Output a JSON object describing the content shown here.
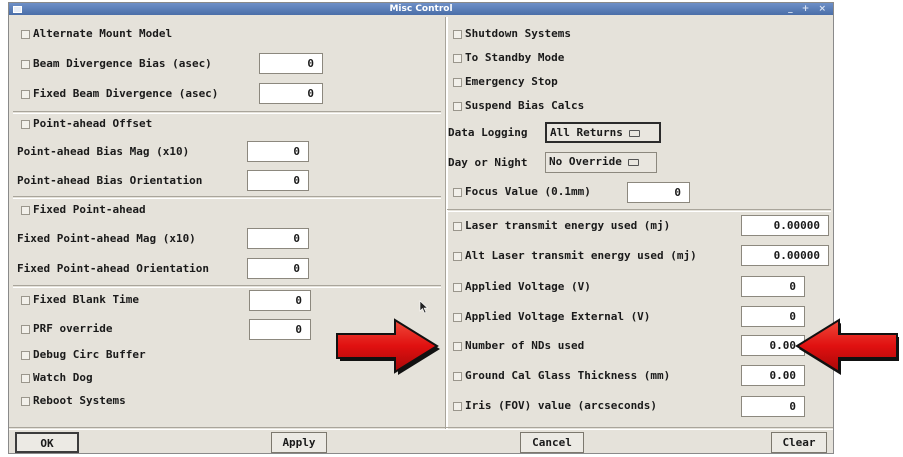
{
  "window": {
    "title": "Misc Control"
  },
  "left": {
    "alternate_mount_model": "Alternate Mount Model",
    "beam_divergence_bias": {
      "label": "Beam Divergence Bias   (asec)",
      "value": "0"
    },
    "fixed_beam_divergence": {
      "label": "Fixed Beam Divergence (asec)",
      "value": "0"
    },
    "point_ahead_offset": "Point-ahead Offset",
    "point_ahead_bias_mag": {
      "label": "Point-ahead Bias Mag (x10)",
      "value": "0"
    },
    "point_ahead_bias_orientation": {
      "label": "Point-ahead Bias Orientation",
      "value": "0"
    },
    "fixed_point_ahead": "Fixed Point-ahead",
    "fixed_point_ahead_mag": {
      "label": "Fixed Point-ahead Mag (x10)",
      "value": "0"
    },
    "fixed_point_ahead_orientation": {
      "label": "Fixed Point-ahead Orientation",
      "value": "0"
    },
    "fixed_blank_time": {
      "label": "Fixed Blank Time",
      "value": "0"
    },
    "prf_override": {
      "label": "PRF override",
      "value": "0"
    },
    "debug_circ_buffer": "Debug Circ Buffer",
    "watch_dog": "Watch Dog",
    "reboot_systems": "Reboot Systems"
  },
  "right": {
    "shutdown_systems": "Shutdown Systems",
    "to_standby_mode": "To Standby Mode",
    "emergency_stop": "Emergency Stop",
    "suspend_bias_calcs": "Suspend Bias Calcs",
    "data_logging": {
      "label": "Data Logging",
      "value": "All Returns"
    },
    "day_or_night": {
      "label": "Day or Night",
      "value": "No Override"
    },
    "focus_value": {
      "label": "Focus Value   (0.1mm)",
      "value": "0"
    },
    "laser_transmit_energy": {
      "label": "Laser transmit energy used (mj)",
      "value": "0.00000"
    },
    "alt_laser_transmit_energy": {
      "label": "Alt Laser transmit energy used (mj)",
      "value": "0.00000"
    },
    "applied_voltage": {
      "label": "Applied Voltage (V)",
      "value": "0"
    },
    "applied_voltage_external": {
      "label": "Applied Voltage External (V)",
      "value": "0"
    },
    "number_of_nds": {
      "label": "Number of NDs used",
      "value": "0.00"
    },
    "ground_cal_glass": {
      "label": "Ground Cal Glass Thickness (mm)",
      "value": "0.00"
    },
    "iris_value": {
      "label": "Iris (FOV) value (arcseconds)",
      "value": "0"
    }
  },
  "buttons": {
    "ok": "OK",
    "apply": "Apply",
    "cancel": "Cancel",
    "clear": "Clear"
  },
  "colors": {
    "arrow": "#e01010",
    "titlebar": "#5b7fb9",
    "panel": "#e5e2da"
  },
  "icons": {
    "titlebar_menu": "window-menu-icon",
    "arrows": "red-arrow-icon",
    "cursor": "mouse-pointer-icon"
  }
}
